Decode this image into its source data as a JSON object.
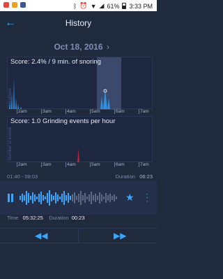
{
  "status_bar": {
    "battery": "61%",
    "time": "3:33 PM"
  },
  "header": {
    "title": "History"
  },
  "date_selector": {
    "date": "Oct 18, 2016"
  },
  "snoring_chart": {
    "score": "Score: 2.4% / 9 min. of snoring",
    "ylabel": "Loudness",
    "time_ticks": [
      "2am",
      "3am",
      "4am",
      "5am",
      "6am",
      "7am"
    ]
  },
  "grinding_chart": {
    "score": "Score: 1.0 Grinding events per hour",
    "ylabel": "Number of events",
    "time_ticks": [
      "2am",
      "3am",
      "4am",
      "5am",
      "6am",
      "7am"
    ]
  },
  "range": {
    "time_range": "01:40 - 08:03",
    "duration_label": "Duration",
    "duration_value": "06:23"
  },
  "player": {
    "time_label": "Time",
    "time_value": "05:32:25",
    "duration_label": "Duration",
    "duration_value": "00:23",
    "accent_color": "#3aa7ff"
  }
}
